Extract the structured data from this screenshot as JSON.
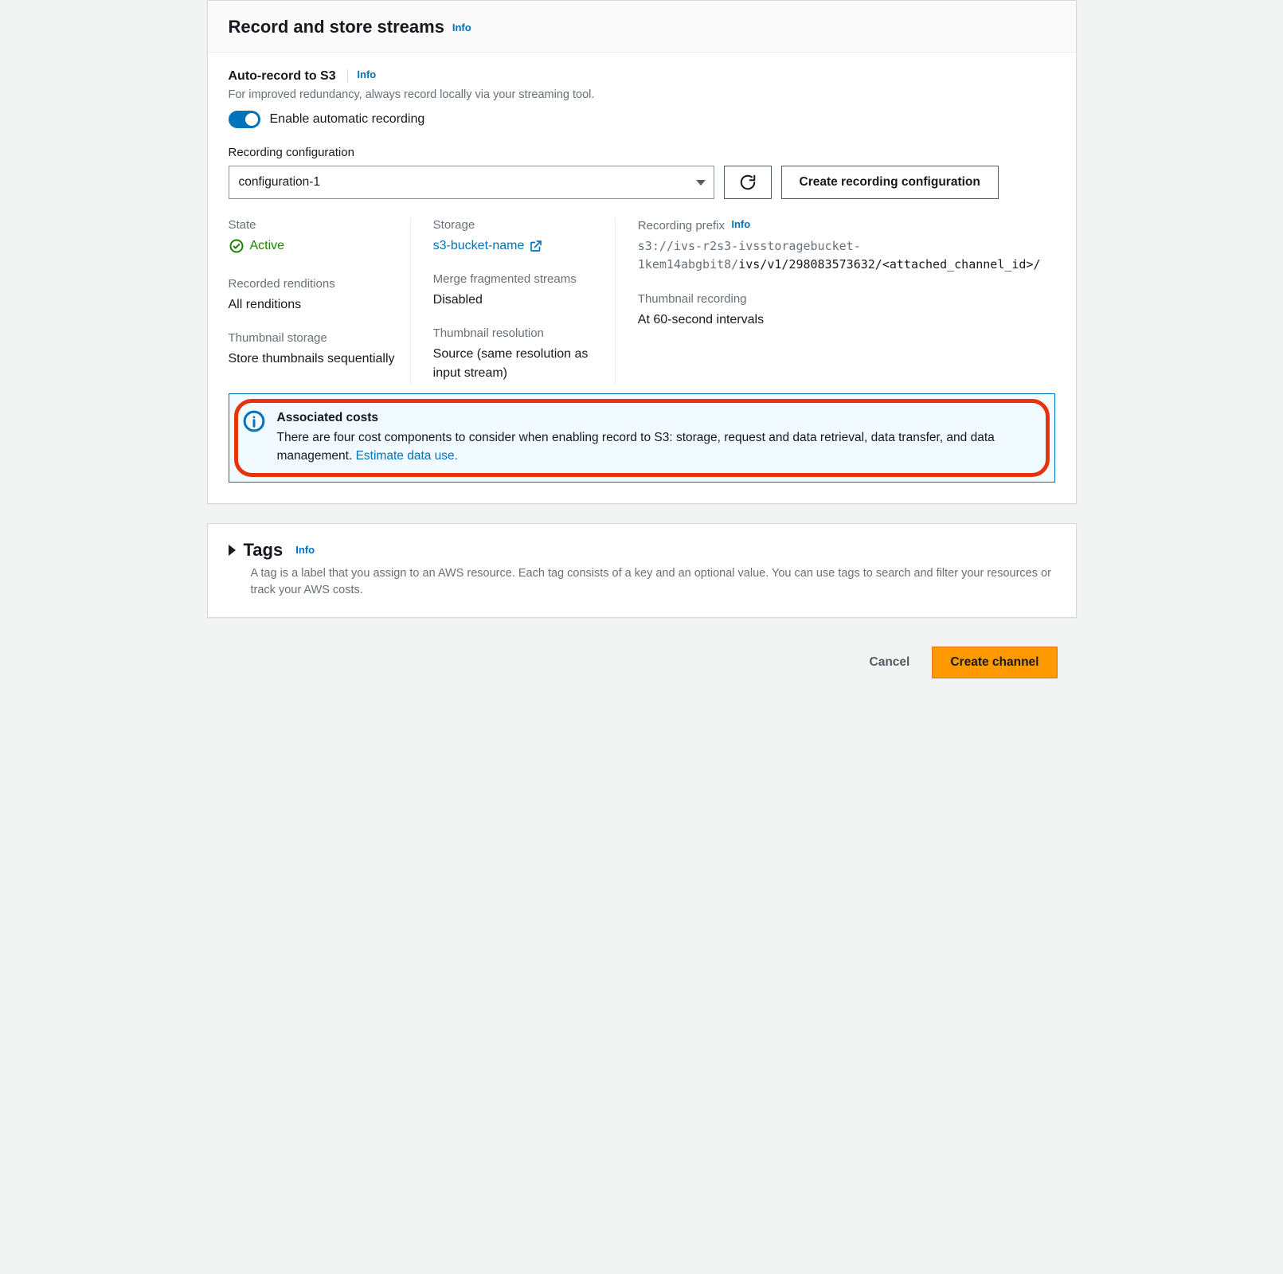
{
  "header": {
    "title": "Record and store streams",
    "info_label": "Info"
  },
  "auto_record": {
    "title": "Auto-record to S3",
    "info_label": "Info",
    "subtext": "For improved redundancy, always record locally via your streaming tool.",
    "toggle_label": "Enable automatic recording"
  },
  "config_selector": {
    "label": "Recording configuration",
    "selected": "configuration-1",
    "create_label": "Create recording configuration"
  },
  "details": {
    "state_label": "State",
    "state_value": "Active",
    "storage_label": "Storage",
    "storage_value": "s3-bucket-name",
    "prefix_label": "Recording prefix",
    "prefix_info_label": "Info",
    "prefix_gray": "s3://ivs-r2s3-ivsstoragebucket-1kem14abgbit8/",
    "prefix_black": "ivs/v1/298083573632/<attached_channel_id>/",
    "renditions_label": "Recorded renditions",
    "renditions_value": "All renditions",
    "merge_label": "Merge fragmented streams",
    "merge_value": "Disabled",
    "thumb_rec_label": "Thumbnail recording",
    "thumb_rec_value": "At 60-second intervals",
    "thumb_store_label": "Thumbnail storage",
    "thumb_store_value": "Store thumbnails sequentially",
    "thumb_res_label": "Thumbnail resolution",
    "thumb_res_value": "Source (same resolution as input stream)"
  },
  "info_box": {
    "title": "Associated costs",
    "body": "There are four cost components to consider when enabling record to S3: storage, request and data retrieval, data transfer, and data management. ",
    "link_label": "Estimate data use."
  },
  "tags": {
    "title": "Tags",
    "info_label": "Info",
    "desc": "A tag is a label that you assign to an AWS resource. Each tag consists of a key and an optional value. You can use tags to search and filter your resources or track your AWS costs."
  },
  "footer": {
    "cancel": "Cancel",
    "create": "Create channel"
  }
}
